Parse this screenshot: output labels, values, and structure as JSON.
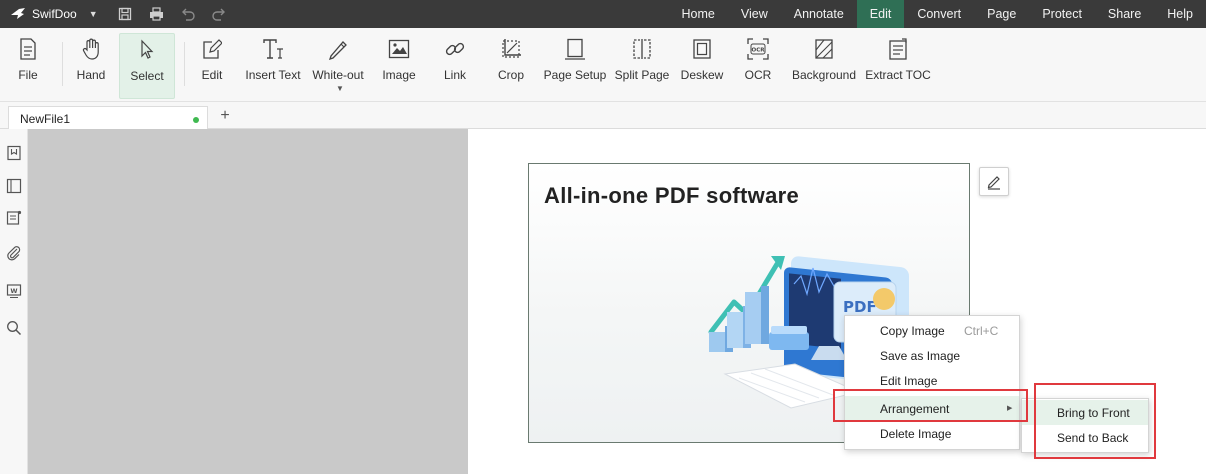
{
  "app": {
    "name": "SwifDoo"
  },
  "menu": [
    "Home",
    "View",
    "Annotate",
    "Edit",
    "Convert",
    "Page",
    "Protect",
    "Share",
    "Help"
  ],
  "menu_active": "Edit",
  "toolbar": {
    "file": "File",
    "hand": "Hand",
    "select": "Select",
    "edit": "Edit",
    "insert_text": "Insert Text",
    "white_out": "White-out",
    "image": "Image",
    "link": "Link",
    "crop": "Crop",
    "page_setup": "Page Setup",
    "split_page": "Split Page",
    "deskew": "Deskew",
    "ocr": "OCR",
    "background": "Background",
    "extract_toc": "Extract TOC"
  },
  "tabs": {
    "doc_name": "NewFile1",
    "add": "+"
  },
  "image": {
    "title": "All-in-one PDF software",
    "badge": "PDF"
  },
  "context_menu": {
    "copy_image": "Copy Image",
    "copy_shortcut": "Ctrl+C",
    "save_as_image": "Save as Image",
    "edit_image": "Edit Image",
    "arrangement": "Arrangement",
    "delete_image": "Delete Image"
  },
  "submenu": {
    "bring_to_front": "Bring to Front",
    "send_to_back": "Send to Back"
  },
  "colors": {
    "accent": "#2f6f55",
    "highlight": "#e6f2ea",
    "annotation": "#e0393e"
  }
}
